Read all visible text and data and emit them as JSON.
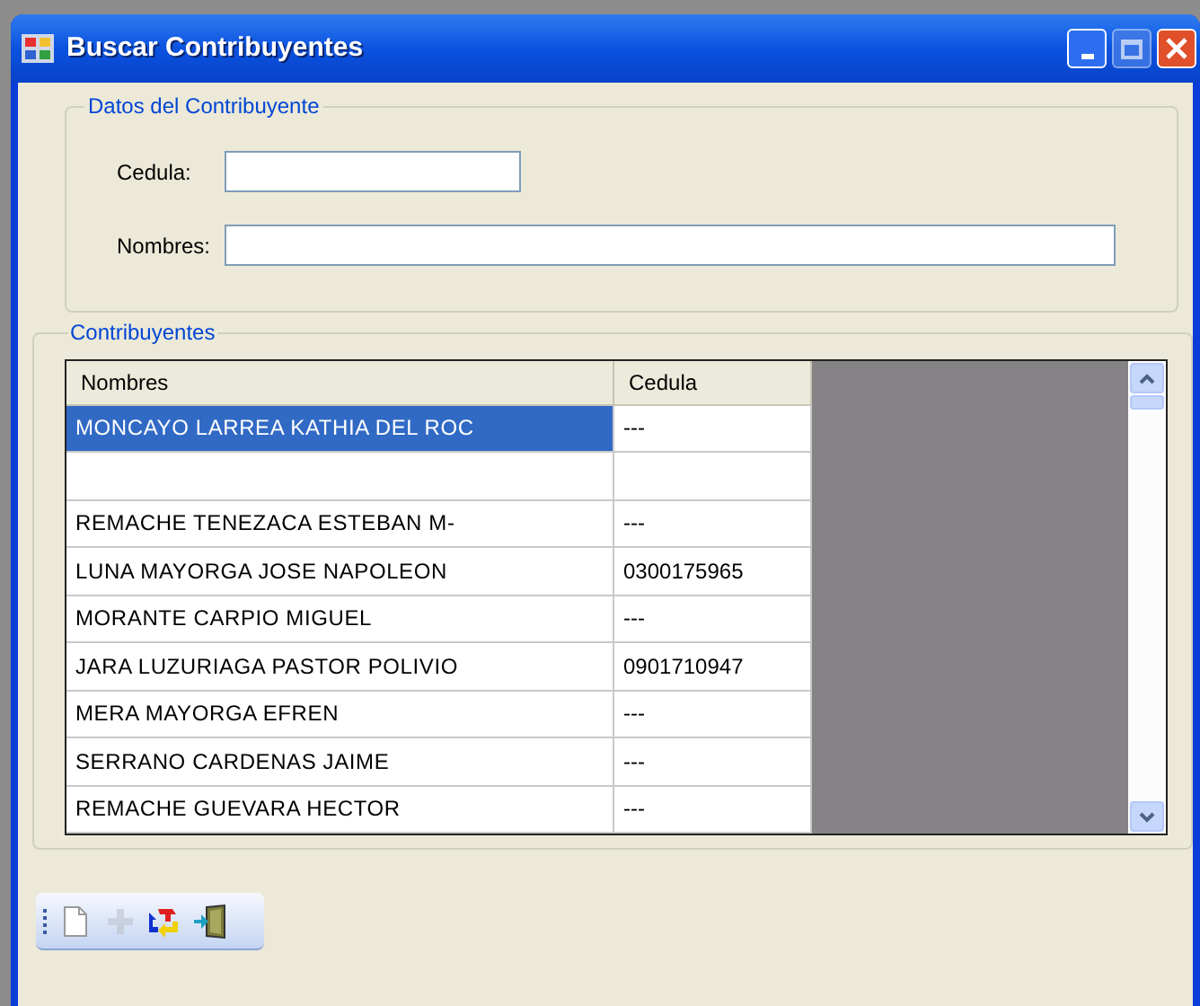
{
  "window": {
    "title": "Buscar Contribuyentes"
  },
  "datos_group": {
    "legend": "Datos del Contribuyente",
    "fields": [
      {
        "label": "Cedula:"
      },
      {
        "label": "Nombres:"
      }
    ]
  },
  "contribuyentes_group": {
    "legend": "Contribuyentes"
  },
  "table": {
    "columns": [
      "Nombres",
      "Cedula"
    ],
    "rows": [
      {
        "nombres": "MONCAYO LARREA KATHIA DEL ROC",
        "cedula": "---",
        "selected": true
      },
      {
        "nombres": "",
        "cedula": "",
        "selected": false
      },
      {
        "nombres": "REMACHE TENEZACA ESTEBAN M-",
        "cedula": "---",
        "selected": false
      },
      {
        "nombres": "LUNA MAYORGA JOSE NAPOLEON",
        "cedula": "0300175965",
        "selected": false
      },
      {
        "nombres": "MORANTE CARPIO MIGUEL",
        "cedula": "---",
        "selected": false
      },
      {
        "nombres": "JARA LUZURIAGA PASTOR POLIVIO",
        "cedula": "0901710947",
        "selected": false
      },
      {
        "nombres": "MERA MAYORGA EFREN",
        "cedula": "---",
        "selected": false
      },
      {
        "nombres": "SERRANO CARDENAS JAIME",
        "cedula": "---",
        "selected": false
      },
      {
        "nombres": "REMACHE GUEVARA HECTOR",
        "cedula": "---",
        "selected": false
      }
    ]
  },
  "toolbar": [
    {
      "disabled": false
    },
    {
      "disabled": true
    },
    {
      "disabled": false
    },
    {
      "disabled": false
    }
  ]
}
